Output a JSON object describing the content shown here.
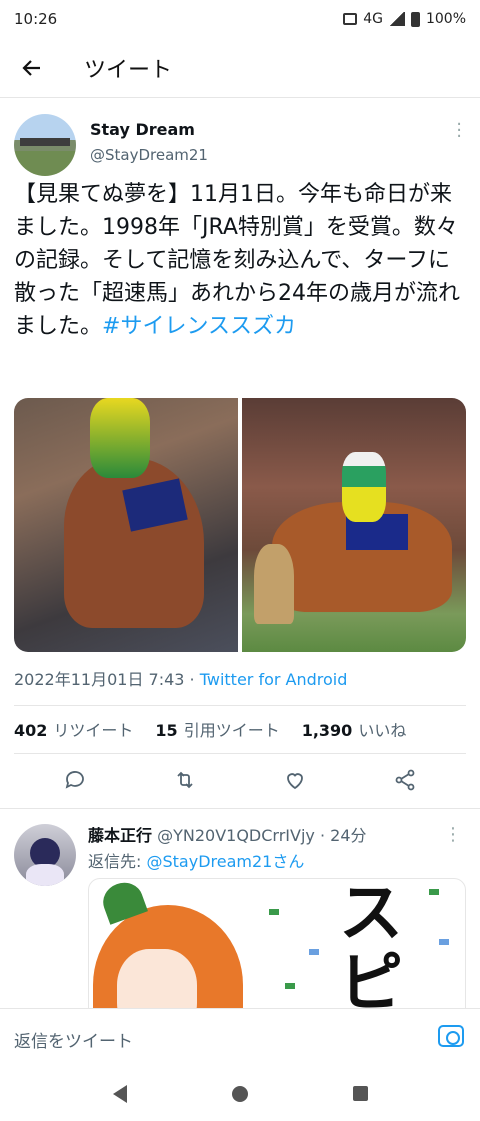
{
  "status": {
    "time": "10:26",
    "network": "4G",
    "battery": "100%"
  },
  "header": {
    "title": "ツイート"
  },
  "tweet": {
    "name": "Stay Dream",
    "handle": "@StayDream21",
    "text": "【見果てぬ夢を】11月1日。今年も命日が来ました。1998年「JRA特別賞」を受賞。数々の記録。そして記憶を刻み込んで、ターフに散った「超速馬」あれから24年の歳月が流れました。",
    "hashtag": "#サイレンススズカ",
    "datetime": "2022年11月01日 7:43",
    "separator": " · ",
    "client": "Twitter for Android",
    "stats": {
      "retweets_count": "402",
      "retweets_label": "リツイート",
      "quotes_count": "15",
      "quotes_label": "引用ツイート",
      "likes_count": "1,390",
      "likes_label": "いいね"
    }
  },
  "reply": {
    "name": "藤本正行",
    "handle": "@YN20V1QDCrrIVjy",
    "time": " · 24分",
    "reply_to_prefix": "返信先: ",
    "reply_to_handle": "@StayDream21さん",
    "image_text": "スピー"
  },
  "composer": {
    "placeholder": "返信をツイート"
  },
  "colors": {
    "accent": "#1d9bf0",
    "text": "#0f1419",
    "muted": "#536471"
  }
}
